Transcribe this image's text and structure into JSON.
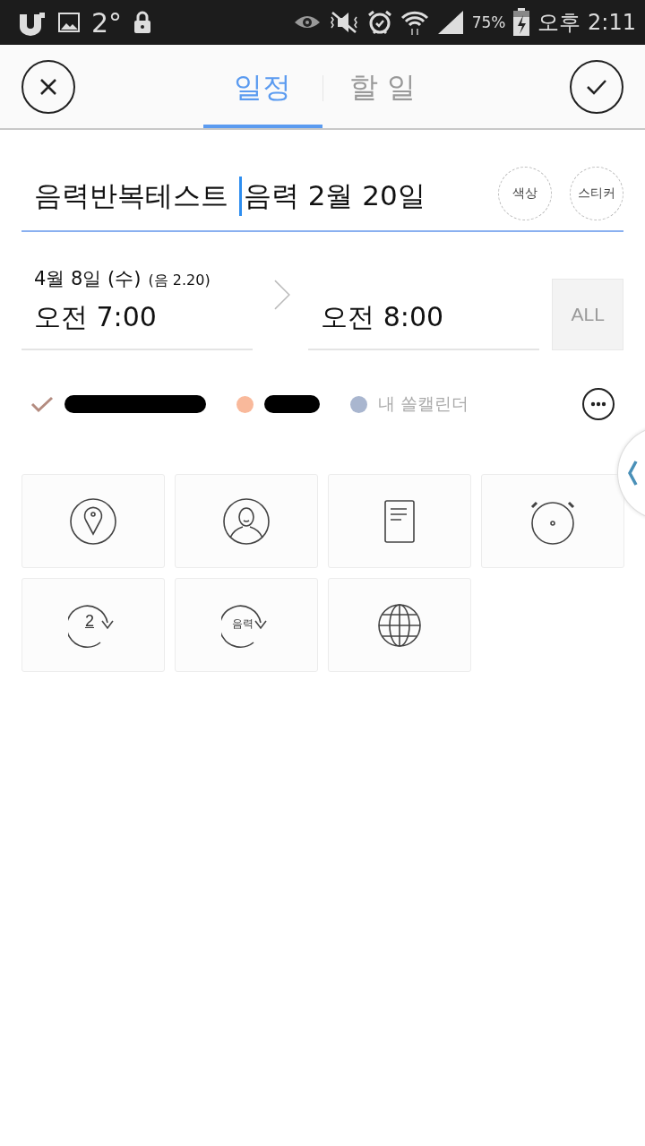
{
  "status_bar": {
    "temperature": "2°",
    "battery": "75%",
    "time": "오후 2:11"
  },
  "header": {
    "tabs": [
      {
        "label": "일정",
        "selected": true
      },
      {
        "label": "할 일",
        "selected": false
      }
    ]
  },
  "title_field": {
    "text_before_cursor": "음력반복테스트 ",
    "text_after_cursor": "음력 2월 20일"
  },
  "title_buttons": [
    "색상",
    "스티커"
  ],
  "date": {
    "label": "4월 8일 (수)",
    "lunar": "(음 2.20)"
  },
  "start_time": "오전 7:00",
  "end_time": "오전 8:00",
  "all_day": {
    "label": "ALL",
    "selected": false
  },
  "calendars": [
    {
      "kind": "check",
      "color": "#b48c80",
      "name_redacted": true
    },
    {
      "kind": "dot",
      "color": "#f9b99b",
      "name_redacted": true
    },
    {
      "kind": "dot",
      "color": "#a9b6cf",
      "name": "내 쏠캘린더"
    }
  ],
  "options": [
    {
      "kind": "location"
    },
    {
      "kind": "person"
    },
    {
      "kind": "memo"
    },
    {
      "kind": "alarm"
    },
    {
      "kind": "repeat",
      "label": "2"
    },
    {
      "kind": "lunar-repeat",
      "label": "음력"
    },
    {
      "kind": "globe"
    }
  ]
}
